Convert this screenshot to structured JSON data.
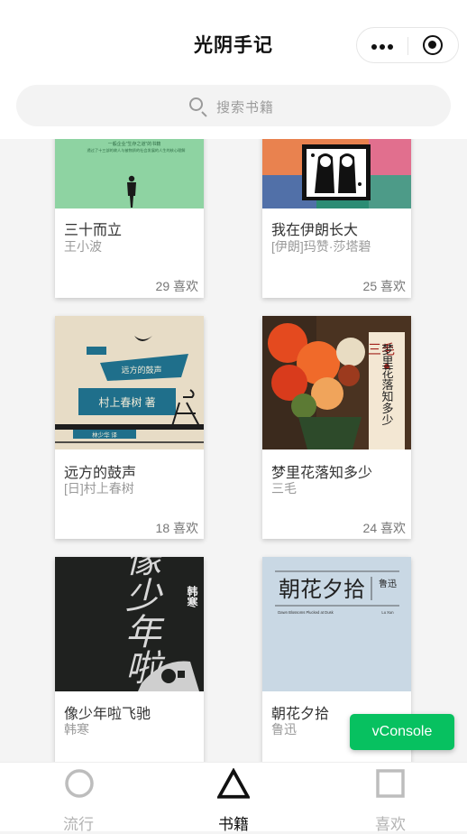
{
  "app": {
    "title": "光阴手记"
  },
  "search": {
    "placeholder": "搜索书籍"
  },
  "books": [
    {
      "title": "三十而立",
      "author": "王小波",
      "likes": "29 喜欢",
      "cover_text": [
        "一般企业\"生存之道\"的书籍",
        "透过了十三部的故人与被物质的社会发展的人生的核心理解"
      ]
    },
    {
      "title": "我在伊朗长大",
      "author": "[伊朗]玛赞·莎塔碧",
      "likes": "25 喜欢"
    },
    {
      "title": "远方的鼓声",
      "author": "[日]村上春树",
      "likes": "18 喜欢",
      "cover_text": [
        "远方的鼓声",
        "村上春树 著",
        "林少华 译"
      ]
    },
    {
      "title": "梦里花落知多少",
      "author": "三毛",
      "likes": "24 喜欢",
      "cover_text": [
        "三毛",
        "梦里花落知多少"
      ]
    },
    {
      "title": "像少年啦飞驰",
      "author": "韩寒",
      "likes": "",
      "cover_text": [
        "像少年啦",
        "韩寒"
      ]
    },
    {
      "title": "朝花夕拾",
      "author": "鲁迅",
      "likes": "",
      "cover_text": [
        "朝花夕拾",
        "鲁迅",
        "Dawn Blossoms Plucked at Dusk",
        "Lu Xun"
      ]
    }
  ],
  "vconsole": {
    "label": "vConsole"
  },
  "tabbar": {
    "items": [
      {
        "label": "流行"
      },
      {
        "label": "书籍"
      },
      {
        "label": "喜欢"
      }
    ]
  },
  "colors": {
    "accent": "#07c160",
    "active_tab": "#111111",
    "inactive_tab": "#b3b3b3"
  }
}
